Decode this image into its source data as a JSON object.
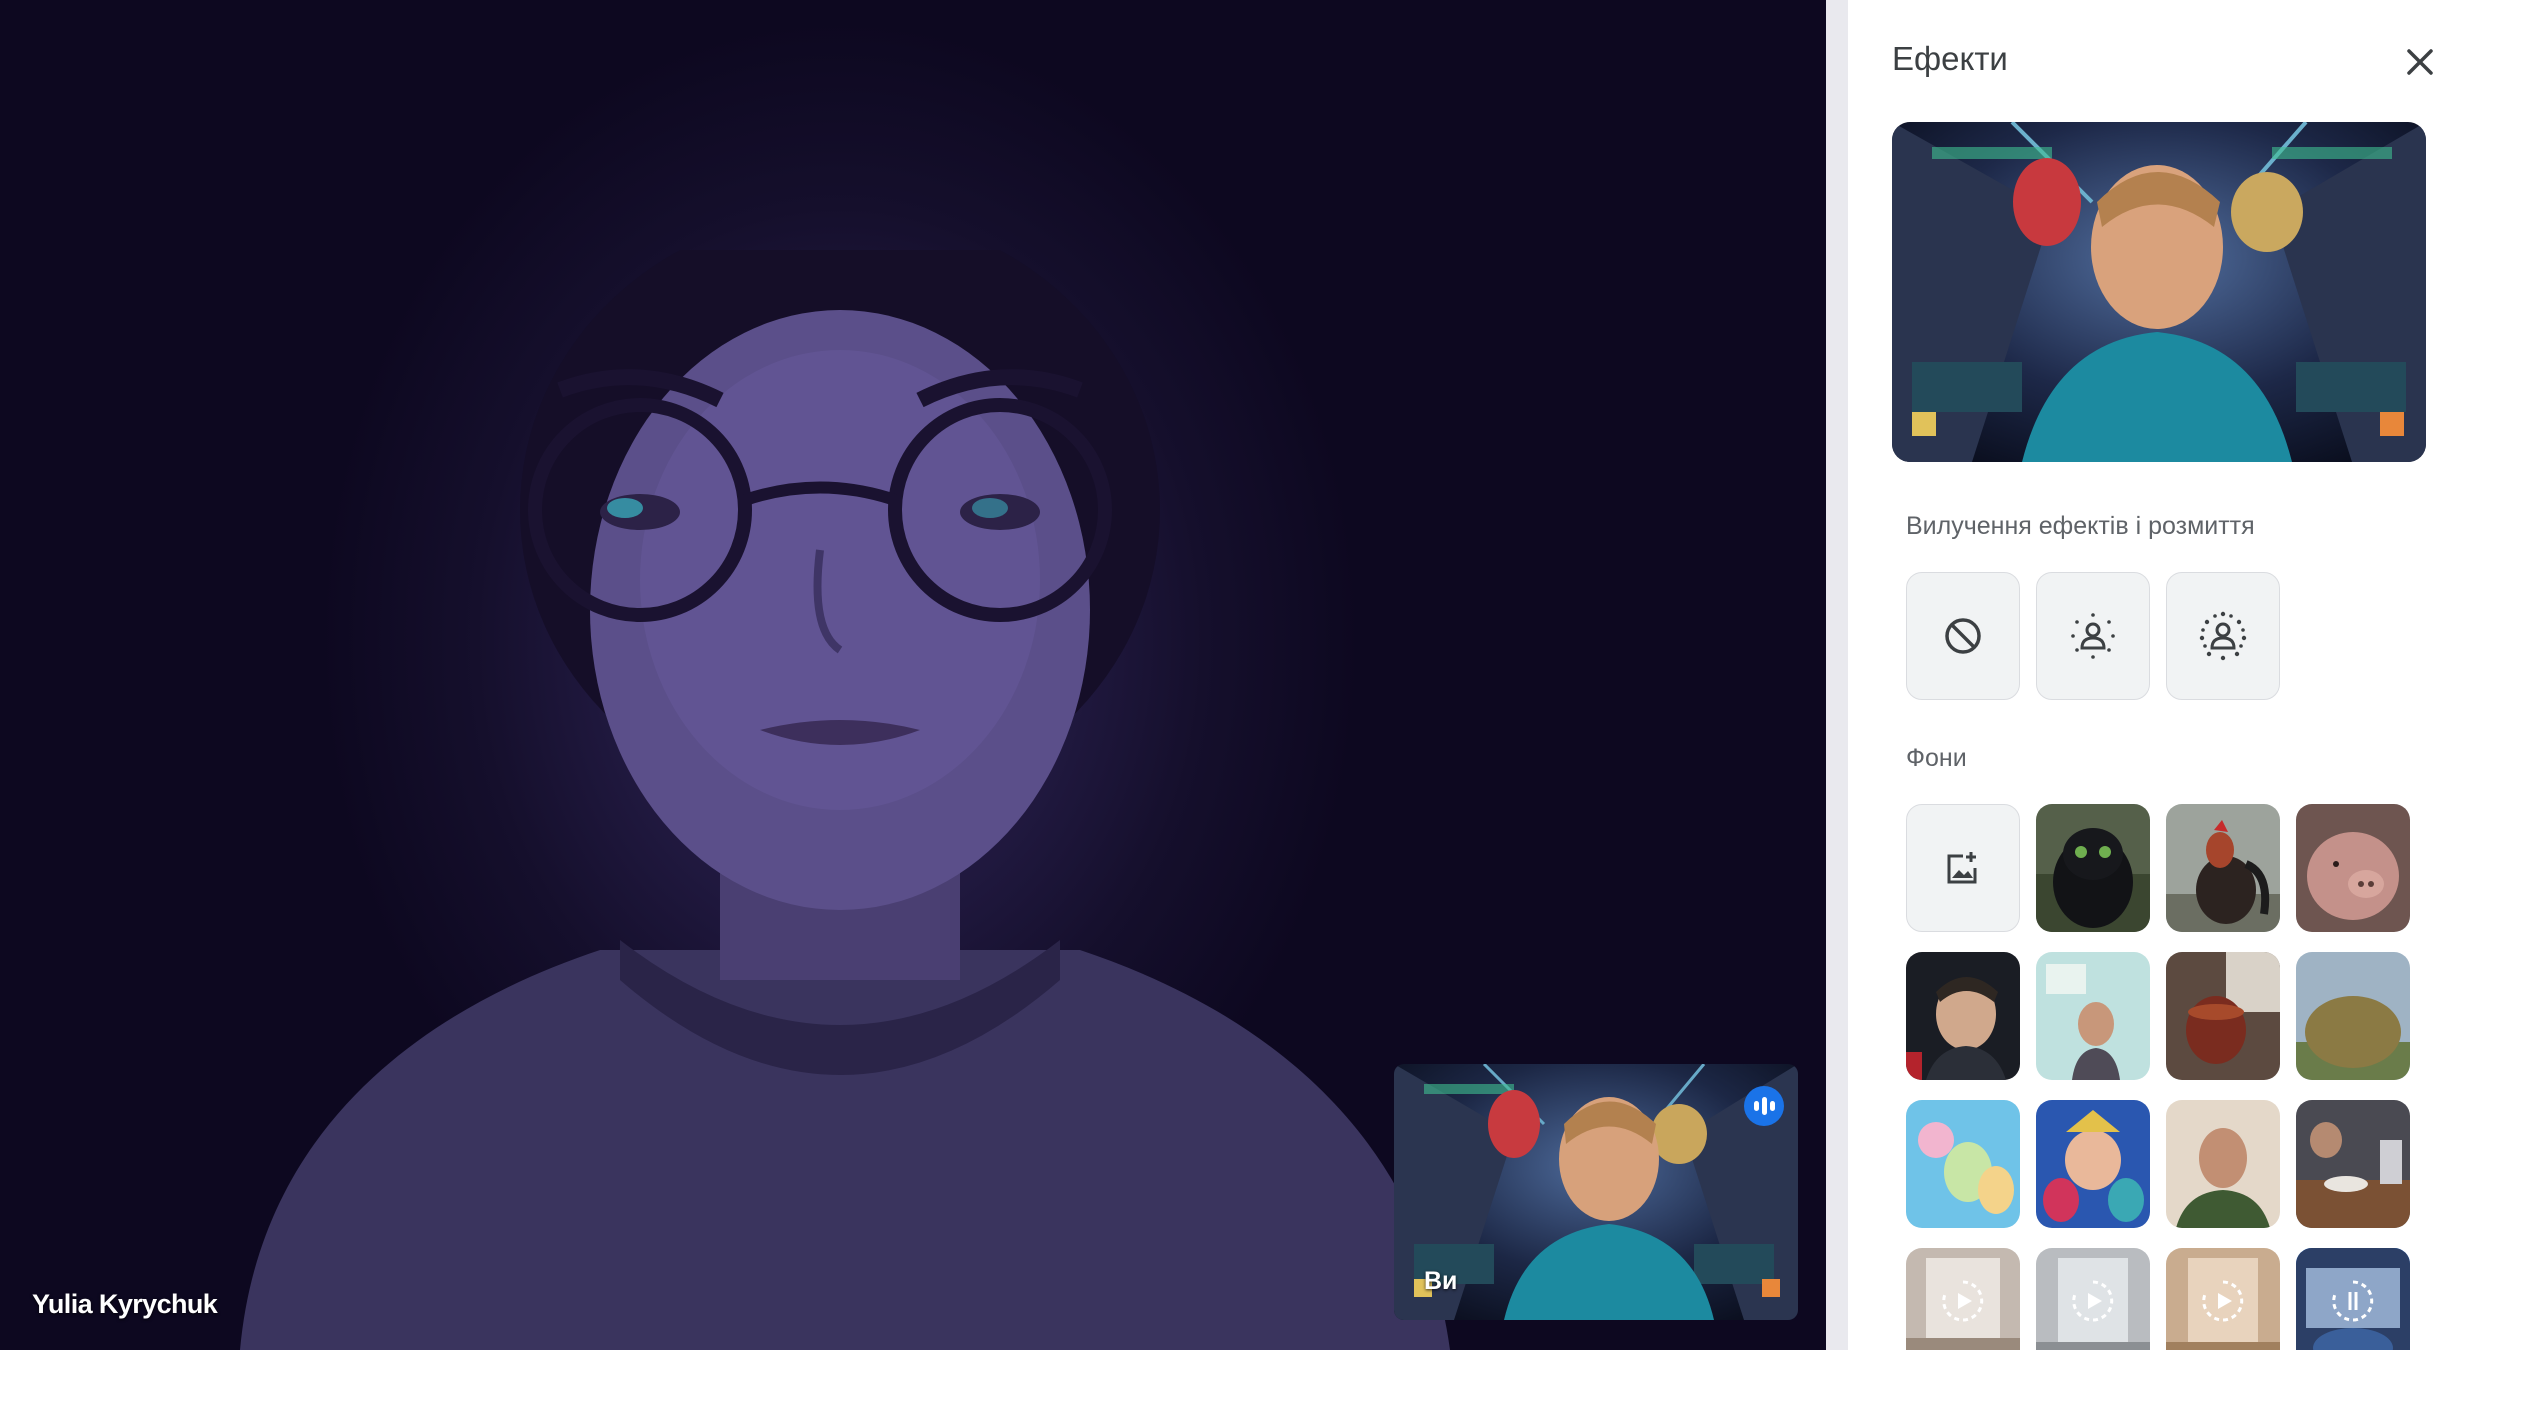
{
  "main_video": {
    "participant_name": "Yulia Kyrychuk"
  },
  "self_view": {
    "label": "Ви",
    "status_icon": "speaking-indicator-icon"
  },
  "effects_panel": {
    "title": "Ефекти",
    "close_icon": "close-icon",
    "section_blur": {
      "label": "Вилучення ефектів і розмиття",
      "options": [
        {
          "icon": "no-effect-icon"
        },
        {
          "icon": "slight-blur-icon"
        },
        {
          "icon": "blur-icon"
        }
      ]
    },
    "section_backgrounds": {
      "label": "Фони",
      "upload_icon": "add-image-icon",
      "thumbnails": [
        {
          "subject": "black-dragon"
        },
        {
          "subject": "rooster"
        },
        {
          "subject": "pig"
        },
        {
          "subject": "selfie-boy"
        },
        {
          "subject": "child-in-class"
        },
        {
          "subject": "tea-cup"
        },
        {
          "subject": "haystack"
        },
        {
          "subject": "cartoon-characters"
        },
        {
          "subject": "underwater-cartoon"
        },
        {
          "subject": "smiling-person"
        },
        {
          "subject": "cafe-table"
        },
        {
          "subject": "room-animated-1",
          "animated": true
        },
        {
          "subject": "room-animated-2",
          "animated": true
        },
        {
          "subject": "room-animated-3",
          "animated": true
        },
        {
          "subject": "spaceship-animated",
          "animated": true,
          "selected": true
        }
      ]
    }
  },
  "colors": {
    "accent": "#1a73e8",
    "panel_bg": "#ffffff",
    "stage_bg": "#0e0922"
  }
}
